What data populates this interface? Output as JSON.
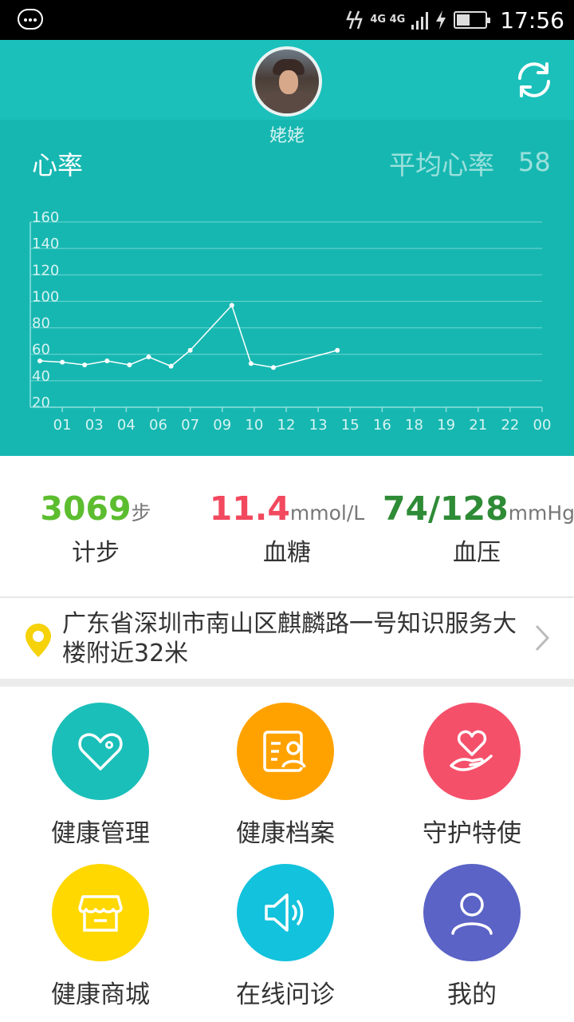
{
  "status_bar": {
    "time": "17:56",
    "network": "4G 4G"
  },
  "header": {
    "username": "姥姥"
  },
  "heart_rate": {
    "title": "心率",
    "average_label": "平均心率",
    "average_value": "58"
  },
  "chart_data": {
    "type": "line",
    "title": "",
    "xlabel": "",
    "ylabel": "",
    "ylim": [
      20,
      160
    ],
    "y_ticks": [
      20,
      40,
      60,
      80,
      100,
      120,
      140,
      160
    ],
    "x_ticks": [
      "01",
      "03",
      "04",
      "06",
      "07",
      "09",
      "10",
      "12",
      "13",
      "15",
      "16",
      "18",
      "19",
      "21",
      "22",
      "00"
    ],
    "x": [
      0.3,
      1.0,
      1.7,
      2.4,
      3.1,
      3.7,
      4.4,
      5.0,
      6.3,
      6.9,
      7.6,
      9.6
    ],
    "values": [
      55,
      54,
      52,
      55,
      52,
      58,
      51,
      63,
      97,
      53,
      50,
      63
    ],
    "grid": true,
    "colors": {
      "line": "#ffffff",
      "grid": "#6fd6d1"
    }
  },
  "stats": [
    {
      "value": "3069",
      "unit": "步",
      "label": "计步",
      "color": "#5cbd2f"
    },
    {
      "value": "11.4",
      "unit": "mmol/L",
      "label": "血糖",
      "color": "#f2495e"
    },
    {
      "value": "74/128",
      "unit": "mmHg",
      "label": "血压",
      "color": "#2e8b36"
    }
  ],
  "location": {
    "address": "广东省深圳市南山区麒麟路一号知识服务大楼附近32米",
    "pin_color": "#f5d20a"
  },
  "menu": [
    {
      "label": "健康管理",
      "icon": "heart-gear-icon",
      "color": "#1bbfb9"
    },
    {
      "label": "健康档案",
      "icon": "profile-card-icon",
      "color": "#ffa200"
    },
    {
      "label": "守护特使",
      "icon": "hand-heart-icon",
      "color": "#f5506a"
    },
    {
      "label": "健康商城",
      "icon": "shop-icon",
      "color": "#ffd800"
    },
    {
      "label": "在线问诊",
      "icon": "speaker-icon",
      "color": "#13c2dc"
    },
    {
      "label": "我的",
      "icon": "user-icon",
      "color": "#5b63c6"
    }
  ]
}
